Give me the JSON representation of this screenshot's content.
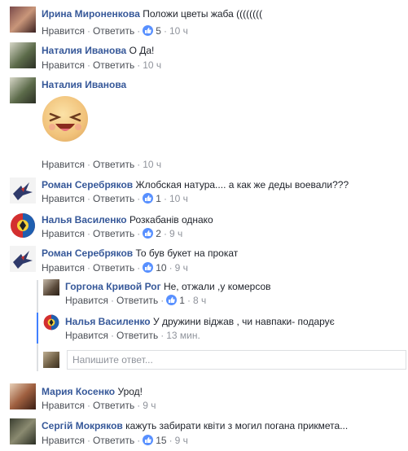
{
  "comments": [
    {
      "name": "Ирина Мироненкова",
      "text": "Положи цветы жаба ((((((((",
      "like": "Нравится",
      "reply": "Ответить",
      "likes": "5",
      "time": "10 ч",
      "avatar": "avatar-irina"
    },
    {
      "name": "Наталия Иванова",
      "text": "О Да!",
      "like": "Нравится",
      "reply": "Ответить",
      "likes": "",
      "time": "10 ч",
      "avatar": "avatar-natalia"
    },
    {
      "name": "Наталия Иванова",
      "text": "",
      "like": "Нравится",
      "reply": "Ответить",
      "likes": "",
      "time": "10 ч",
      "avatar": "avatar-natalia",
      "sticker": "laughing-sticker"
    },
    {
      "name": "Роман Серебряков",
      "text": "Жлобская натура.... а как же деды воевали???",
      "like": "Нравится",
      "reply": "Ответить",
      "likes": "1",
      "time": "10 ч",
      "avatar": "avatar-roman"
    },
    {
      "name": "Налья Василенко",
      "text": "Розкабанів однако",
      "like": "Нравится",
      "reply": "Ответить",
      "likes": "2",
      "time": "9 ч",
      "avatar": "avatar-nalya"
    },
    {
      "name": "Роман Серебряков",
      "text": "То був букет на прокат",
      "like": "Нравится",
      "reply": "Ответить",
      "likes": "10",
      "time": "9 ч",
      "avatar": "avatar-roman"
    },
    {
      "name": "Гоpгона Кривой Рог",
      "text": "Не, отжали ,у комерсов",
      "like": "Нравится",
      "reply": "Ответить",
      "likes": "1",
      "time": "8 ч",
      "avatar": "avatar-gorgona"
    },
    {
      "name": "Налья Василенко",
      "text": "У дружини віджав , чи навпаки- подарує",
      "like": "Нравится",
      "reply": "Ответить",
      "likes": "",
      "time": "13 мин.",
      "avatar": "avatar-nalya"
    },
    {
      "name": "Мария Косенко",
      "text": "Урод!",
      "like": "Нравится",
      "reply": "Ответить",
      "likes": "",
      "time": "9 ч",
      "avatar": "avatar-maria"
    },
    {
      "name": "Сергій Мокряков",
      "text": "кажуть забирати квіти з могил погана прикмета...",
      "like": "Нравится",
      "reply": "Ответить",
      "likes": "15",
      "time": "9 ч",
      "avatar": "avatar-sergii"
    }
  ],
  "reply_box": {
    "placeholder": "Напишите ответ..."
  },
  "colors": {
    "name": "#365899",
    "link": "#4b4f56",
    "meta": "#90949c",
    "like_badge": "#5890ff"
  }
}
